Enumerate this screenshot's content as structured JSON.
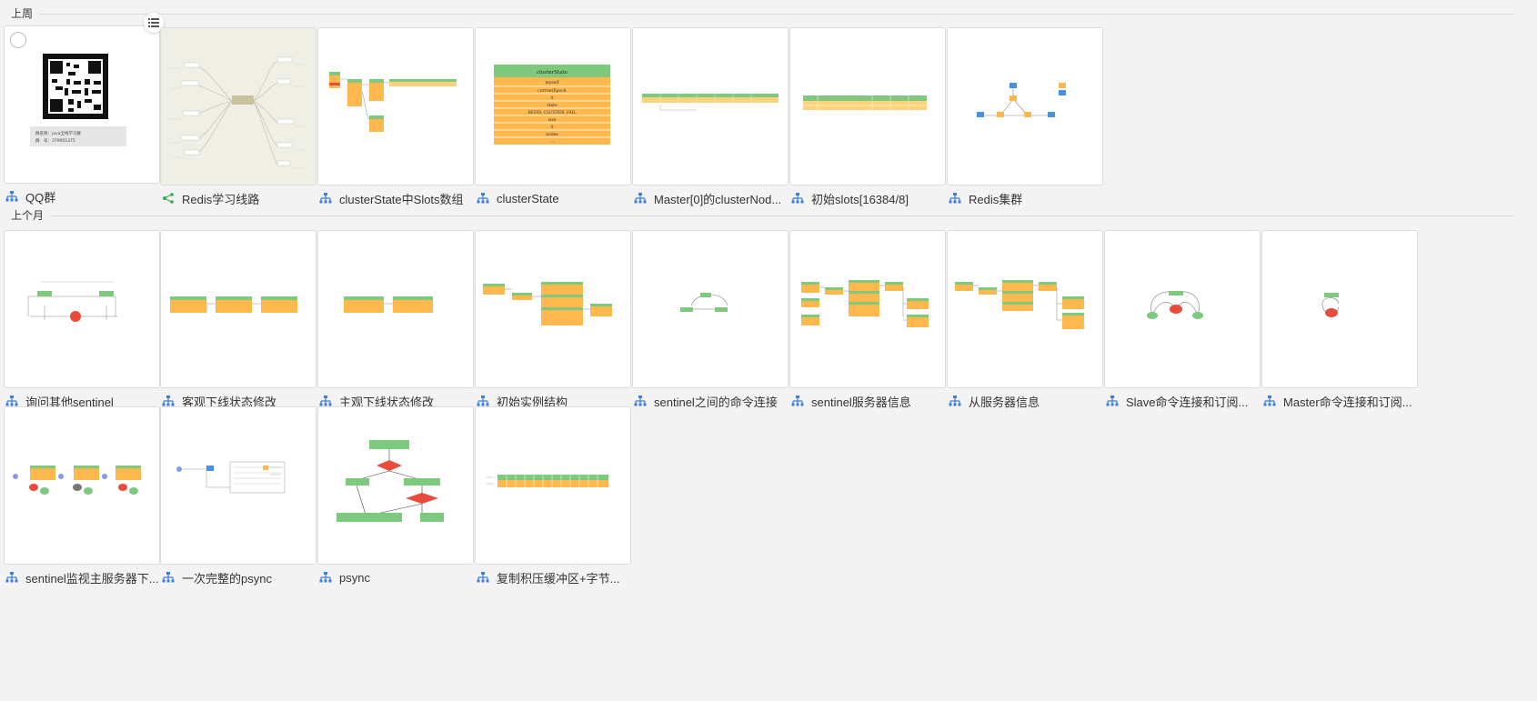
{
  "sections": [
    {
      "label": "上周",
      "items": [
        {
          "title": "QQ群",
          "icon": "org-chart-icon"
        },
        {
          "title": "Redis学习线路",
          "icon": "mindmap-icon"
        },
        {
          "title": "clusterState中Slots数组",
          "icon": "org-chart-icon"
        },
        {
          "title": "clusterState",
          "icon": "org-chart-icon"
        },
        {
          "title": "Master[0]的clusterNod...",
          "icon": "org-chart-icon"
        },
        {
          "title": "初始slots[16384/8]",
          "icon": "org-chart-icon"
        },
        {
          "title": "Redis集群",
          "icon": "org-chart-icon"
        }
      ]
    },
    {
      "label": "上个月",
      "items": [
        {
          "title": "询问其他sentinel",
          "icon": "org-chart-icon"
        },
        {
          "title": "客观下线状态修改",
          "icon": "org-chart-icon"
        },
        {
          "title": "主观下线状态修改",
          "icon": "org-chart-icon"
        },
        {
          "title": "初始实例结构",
          "icon": "org-chart-icon"
        },
        {
          "title": "sentinel之间的命令连接",
          "icon": "org-chart-icon"
        },
        {
          "title": "sentinel服务器信息",
          "icon": "org-chart-icon"
        },
        {
          "title": "从服务器信息",
          "icon": "org-chart-icon"
        },
        {
          "title": "Slave命令连接和订阅...",
          "icon": "org-chart-icon"
        },
        {
          "title": "Master命令连接和订阅...",
          "icon": "org-chart-icon"
        },
        {
          "title": "sentinel监视主服务器下...",
          "icon": "org-chart-icon"
        },
        {
          "title": "一次完整的psync",
          "icon": "org-chart-icon"
        },
        {
          "title": "psync",
          "icon": "org-chart-icon"
        },
        {
          "title": "复制积压缓冲区+字节...",
          "icon": "org-chart-icon"
        }
      ]
    }
  ],
  "thumb_text": {
    "qq_group_line1": "群名称：java全栈学习群",
    "qq_group_line2": "群　号：379001375",
    "cluster_state_header": "clusterState",
    "cluster_state_rows": [
      "myself",
      "currentEpoch",
      "0",
      "state",
      "REDIS_CLUSTER_FAIL",
      "size",
      "0",
      "nodes",
      "..."
    ]
  },
  "colors": {
    "org_icon": "#3f7fd6",
    "mindmap_icon": "#3aa657",
    "green": "#7ec97e",
    "orange": "#ffb84d",
    "red": "#e84a3c",
    "blue": "#4a90e2"
  }
}
